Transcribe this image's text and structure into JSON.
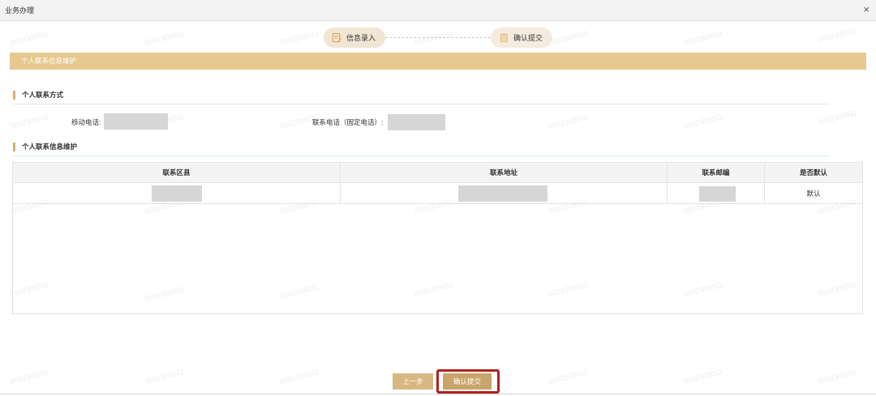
{
  "window": {
    "title": "业务办理",
    "close_glyph": "×"
  },
  "watermark_text": "0002308011",
  "steps": [
    {
      "label": "信息录入",
      "icon": "edit-doc-icon"
    },
    {
      "label": "确认提交",
      "icon": "clipboard-icon"
    }
  ],
  "section": {
    "title": "个人联系信息维护"
  },
  "contact": {
    "heading": "个人联系方式",
    "mobile_label": "移动电话:",
    "landline_label": "联系电话（固定电话）:"
  },
  "maintenance": {
    "heading": "个人联系信息维护",
    "columns": [
      "联系区县",
      "联系地址",
      "联系邮编",
      "是否默认"
    ],
    "rows": [
      {
        "default": "默认"
      }
    ]
  },
  "buttons": {
    "prev": "上一步",
    "confirm": "确认提交"
  },
  "colors": {
    "accent": "#e6c98f",
    "button": "#c9a56b",
    "highlight": "#b1221d"
  }
}
